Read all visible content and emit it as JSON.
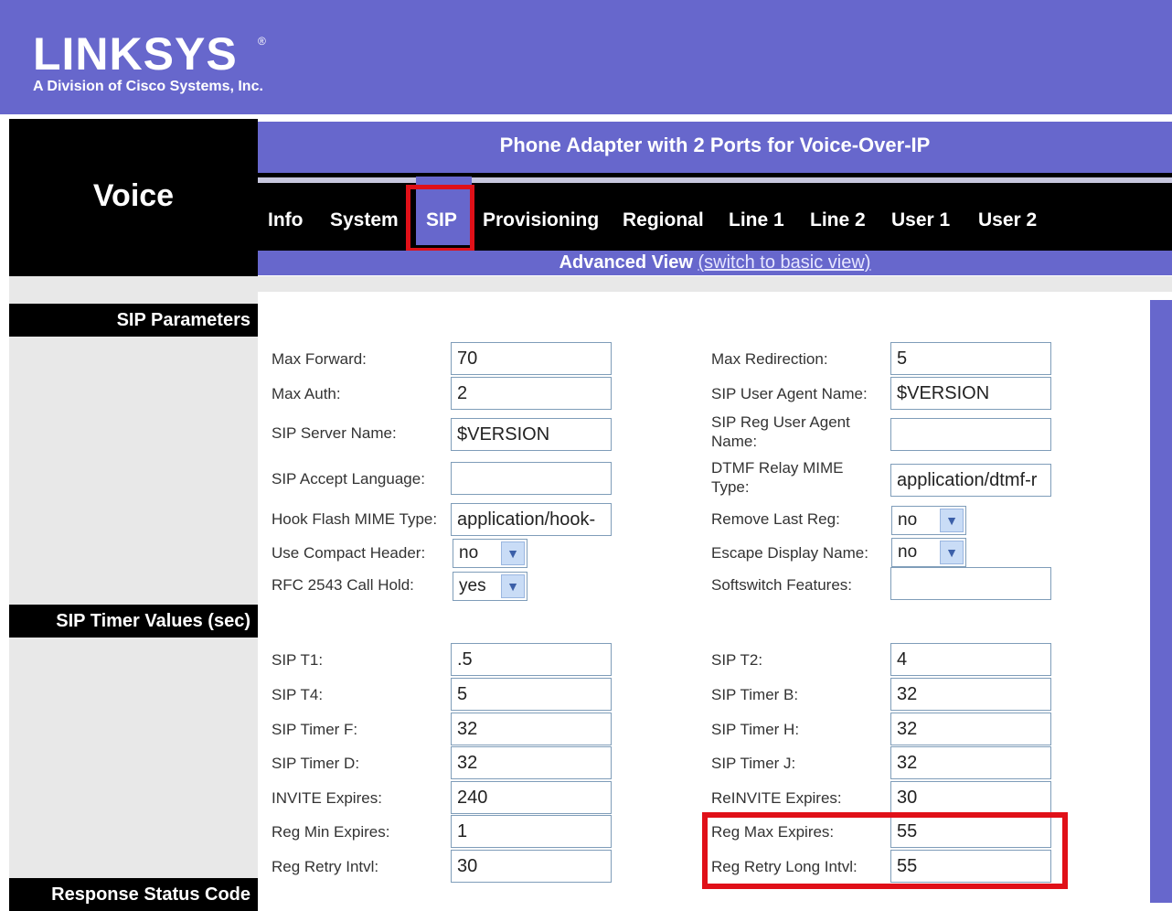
{
  "header": {
    "logo_text": "LINKSYS",
    "logo_subtitle": "A Division of Cisco Systems, Inc.",
    "reg_mark": "®",
    "section_title": "Voice",
    "product_title": "Phone Adapter with 2 Ports for Voice-Over-IP"
  },
  "nav": {
    "tabs": [
      "Info",
      "System",
      "SIP",
      "Provisioning",
      "Regional",
      "Line 1",
      "Line 2",
      "User 1",
      "User 2"
    ],
    "active_tab": "SIP"
  },
  "view": {
    "current": "Advanced View",
    "switch_link": "(switch to basic view)"
  },
  "sections": {
    "sip_parameters": "SIP Parameters",
    "sip_timer_values": "SIP Timer Values (sec)",
    "response_status_code": "Response Status Code"
  },
  "sip_parameters": {
    "max_forward": {
      "label": "Max Forward:",
      "value": "70"
    },
    "max_redirection": {
      "label": "Max Redirection:",
      "value": "5"
    },
    "max_auth": {
      "label": "Max Auth:",
      "value": "2"
    },
    "sip_user_agent_name": {
      "label": "SIP User Agent Name:",
      "value": "$VERSION"
    },
    "sip_server_name": {
      "label": "SIP Server Name:",
      "value": "$VERSION"
    },
    "sip_reg_user_agent_name": {
      "label_line1": "SIP Reg User Agent",
      "label_line2": "Name:",
      "value": ""
    },
    "sip_accept_language": {
      "label": "SIP Accept Language:",
      "value": ""
    },
    "dtmf_relay_mime_type": {
      "label_line1": "DTMF Relay MIME",
      "label_line2": "Type:",
      "value": "application/dtmf-r"
    },
    "hook_flash_mime_type": {
      "label": "Hook Flash MIME Type:",
      "value": "application/hook-"
    },
    "remove_last_reg": {
      "label": "Remove Last Reg:",
      "value": "no"
    },
    "use_compact_header": {
      "label": "Use Compact Header:",
      "value": "no"
    },
    "escape_display_name": {
      "label": "Escape Display Name:",
      "value": "no"
    },
    "rfc_2543_call_hold": {
      "label": "RFC 2543 Call Hold:",
      "value": "yes"
    },
    "softswitch_features": {
      "label": "Softswitch Features:",
      "value": ""
    }
  },
  "sip_timers": {
    "sip_t1": {
      "label": "SIP T1:",
      "value": ".5"
    },
    "sip_t2": {
      "label": "SIP T2:",
      "value": "4"
    },
    "sip_t4": {
      "label": "SIP T4:",
      "value": "5"
    },
    "sip_timer_b": {
      "label": "SIP Timer B:",
      "value": "32"
    },
    "sip_timer_f": {
      "label": "SIP Timer F:",
      "value": "32"
    },
    "sip_timer_h": {
      "label": "SIP Timer H:",
      "value": "32"
    },
    "sip_timer_d": {
      "label": "SIP Timer D:",
      "value": "32"
    },
    "sip_timer_j": {
      "label": "SIP Timer J:",
      "value": "32"
    },
    "invite_expires": {
      "label": "INVITE Expires:",
      "value": "240"
    },
    "reinvite_expires": {
      "label": "ReINVITE Expires:",
      "value": "30"
    },
    "reg_min_expires": {
      "label": "Reg Min Expires:",
      "value": "1"
    },
    "reg_max_expires": {
      "label": "Reg Max Expires:",
      "value": "55"
    },
    "reg_retry_intvl": {
      "label": "Reg Retry Intvl:",
      "value": "30"
    },
    "reg_retry_long_intvl": {
      "label": "Reg Retry Long Intvl:",
      "value": "55"
    }
  },
  "colors": {
    "brand_purple": "#6767cc",
    "highlight_red": "#e01018"
  }
}
